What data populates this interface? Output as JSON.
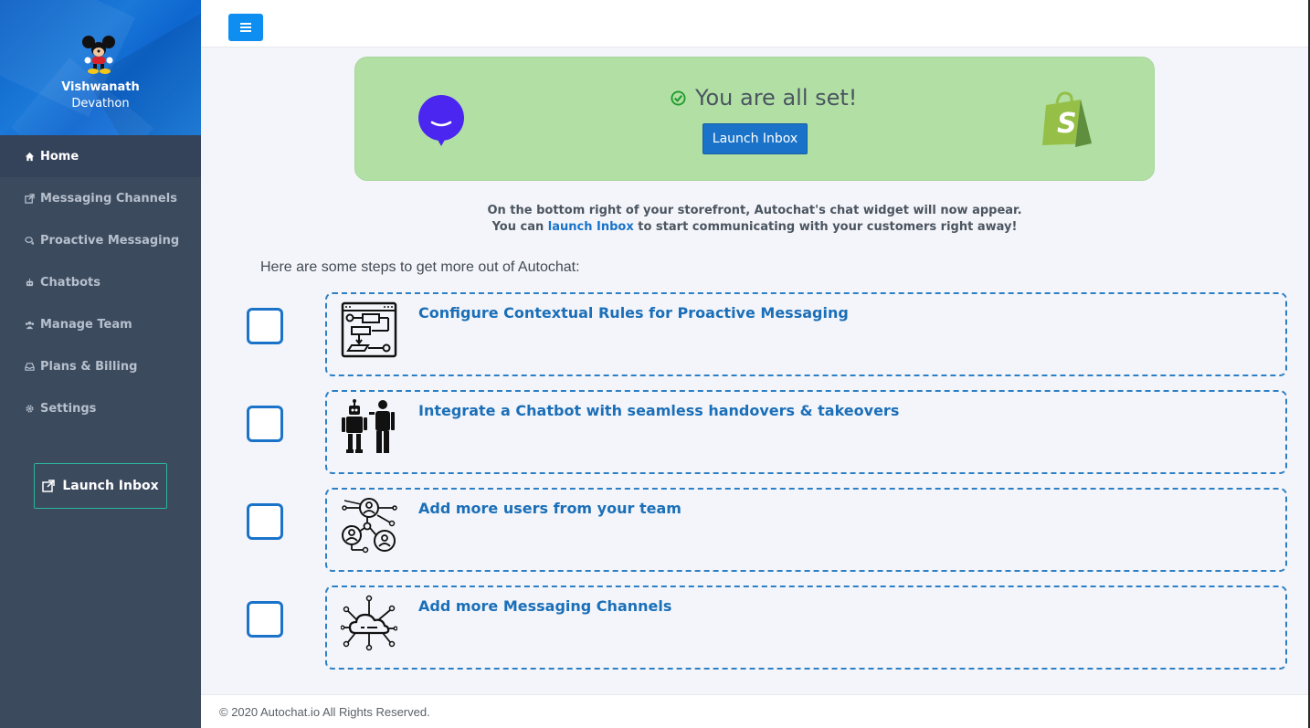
{
  "user": {
    "first_name": "Vishwanath",
    "last_name": "Devathon"
  },
  "sidebar": {
    "items": [
      {
        "label": "Home",
        "icon": "home-icon",
        "active": true
      },
      {
        "label": "Messaging Channels",
        "icon": "external-link-icon",
        "active": false
      },
      {
        "label": "Proactive Messaging",
        "icon": "chat-bubbles-icon",
        "active": false
      },
      {
        "label": "Chatbots",
        "icon": "robot-icon",
        "active": false
      },
      {
        "label": "Manage Team",
        "icon": "users-icon",
        "active": false
      },
      {
        "label": "Plans & Billing",
        "icon": "inbox-tray-icon",
        "active": false
      },
      {
        "label": "Settings",
        "icon": "gear-icon",
        "active": false
      }
    ],
    "launch_label": "Launch Inbox"
  },
  "banner": {
    "status": "You are all set!",
    "button_label": "Launch Inbox",
    "bg_color": "#b2e0a4"
  },
  "info": {
    "line1": "On the bottom right of your storefront, Autochat's chat widget will now appear.",
    "line2_prefix": "You can ",
    "line2_link": "launch Inbox",
    "line2_suffix": " to start communicating with your customers right away!"
  },
  "steps_heading": "Here are some steps to get more out of Autochat:",
  "steps": [
    {
      "title": "Configure Contextual Rules for Proactive Messaging",
      "icon": "flowchart-icon",
      "checked": false
    },
    {
      "title": "Integrate a Chatbot with seamless handovers & takeovers",
      "icon": "robot-human-icon",
      "checked": false
    },
    {
      "title": "Add more users from your team",
      "icon": "team-network-icon",
      "checked": false
    },
    {
      "title": "Add more Messaging Channels",
      "icon": "cloud-network-icon",
      "checked": false
    }
  ],
  "footer": "© 2020 Autochat.io All Rights Reserved.",
  "colors": {
    "accent": "#1a73c9",
    "sidebar": "#3c4a5e",
    "toggle": "#0d8ef0"
  }
}
